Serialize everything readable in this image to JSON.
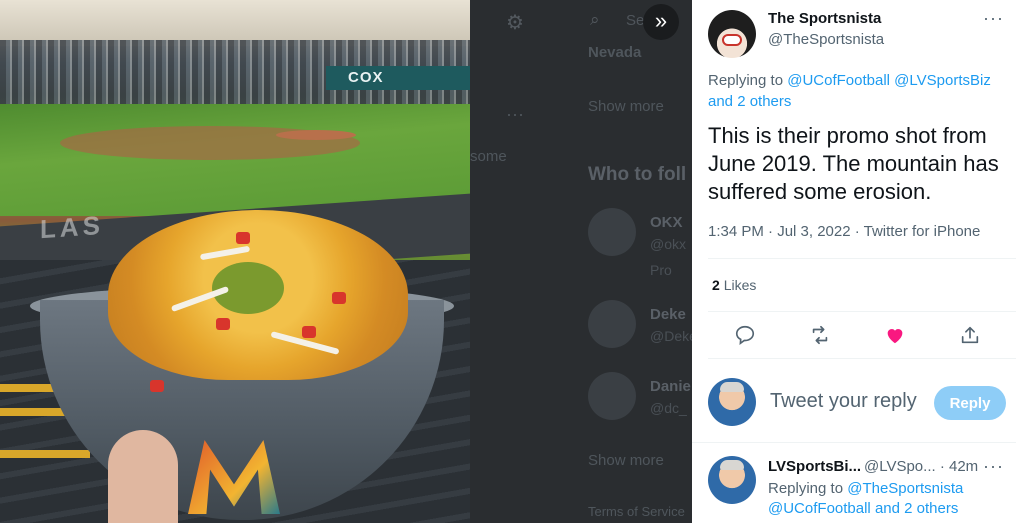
{
  "photo": {
    "scoreboard_text": "COX",
    "wall_text": "LAS"
  },
  "background_page": {
    "search_placeholder": "Se",
    "trend_location": "Nevada",
    "show_more_1": "Show more",
    "some_text": "some",
    "who_to_follow": "Who to foll",
    "suggestions": [
      {
        "name": "OKX",
        "handle": "@okx",
        "extra": "Pro"
      },
      {
        "name": "Deke",
        "handle": "@Deke"
      },
      {
        "name": "Danie",
        "handle": "@dc_"
      }
    ],
    "show_more_2": "Show more",
    "terms": "Terms of Service"
  },
  "tweet": {
    "author_name": "The Sportsnista",
    "author_handle": "@TheSportsnista",
    "replying_to_label": "Replying to",
    "replying_to_link_1": "@UCofFootball",
    "replying_to_link_2": "@LVSportsBiz",
    "replying_to_and": "and 2 others",
    "text": "This is their promo shot from June 2019. The mountain has suffered some erosion.",
    "meta": "1:34 PM · Jul 3, 2022 · Twitter for iPhone",
    "likes_count": "2",
    "likes_label": "Likes",
    "liked_color": "#f91880"
  },
  "reply_box": {
    "placeholder": "Tweet your reply",
    "button_label": "Reply"
  },
  "reply_tweet": {
    "author_name": "LVSportsBi...",
    "author_handle": "@LVSpo...",
    "time": "· 42m",
    "replying_to_label": "Replying to",
    "link_1": "@TheSportsnista",
    "link_2": "@UCofFootball",
    "and_others": "and 2 others"
  },
  "colors": {
    "accent": "#1d9bf0",
    "reply_button_disabled": "#8ecdf7",
    "secondary_text": "#536471"
  }
}
